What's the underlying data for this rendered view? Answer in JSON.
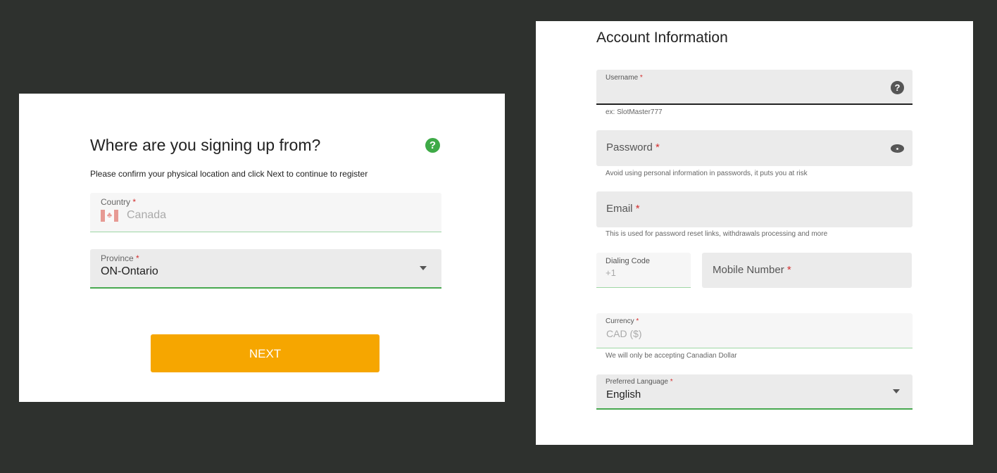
{
  "location": {
    "title": "Where are you signing up from?",
    "help_icon": "question-circle-icon",
    "subtitle": "Please confirm your physical location and click Next to continue to register",
    "country": {
      "label": "Country",
      "required_mark": "*",
      "value": "Canada",
      "flag": "canada-flag-icon"
    },
    "province": {
      "label": "Province",
      "required_mark": "*",
      "value": "ON-Ontario"
    },
    "next_label": "NEXT",
    "colors": {
      "accent_green": "#3eaa47",
      "button_orange": "#f6a600"
    }
  },
  "account": {
    "title": "Account Information",
    "username": {
      "label": "Username",
      "required_mark": "*",
      "hint": "ex: SlotMaster777"
    },
    "password": {
      "label": "Password",
      "required_mark": "*",
      "hint": "Avoid using personal information in passwords, it puts you at risk"
    },
    "email": {
      "label": "Email",
      "required_mark": "*",
      "hint": "This is used for password reset links, withdrawals processing and more"
    },
    "dialing_code": {
      "label": "Dialing Code",
      "value": "+1"
    },
    "mobile": {
      "label": "Mobile Number",
      "required_mark": "*"
    },
    "currency": {
      "label": "Currency",
      "required_mark": "*",
      "value": "CAD ($)",
      "hint": "We will only be accepting Canadian Dollar"
    },
    "language": {
      "label": "Preferred Language",
      "required_mark": "*",
      "value": "English"
    }
  }
}
